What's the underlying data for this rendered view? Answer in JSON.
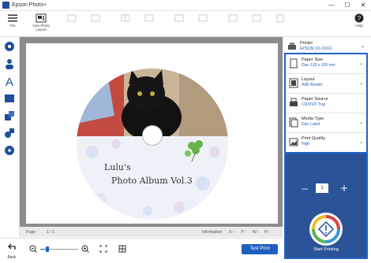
{
  "window": {
    "title": "Epson Photo+",
    "minimize": "—",
    "maximize": "☐",
    "close": "✕"
  },
  "toolbar": {
    "file_label": "File",
    "auto_photo_label": "Auto Photo\nLayout",
    "help_label": "Help"
  },
  "canvas": {
    "album_line1": "Lulu's",
    "album_line2": "Photo Album Vol.3"
  },
  "status": {
    "page_label": "Page:",
    "page_value": "1 / 1",
    "info_label": "Information:",
    "info_x": "X:-",
    "info_y": "Y:-",
    "info_w": "W:-",
    "info_h": "H:-"
  },
  "bottom": {
    "back_label": "Back",
    "test_print": "Test Print"
  },
  "printer": {
    "label": "Printer",
    "value": "EPSON XX-XXXX"
  },
  "settings": [
    {
      "label": "Paper Size",
      "value": "Disc 120 x 120 mm",
      "icon": "paper-size-icon"
    },
    {
      "label": "Layout",
      "value": "With Border",
      "icon": "layout-icon"
    },
    {
      "label": "Paper Source",
      "value": "CD/DVD Tray",
      "icon": "paper-source-icon"
    },
    {
      "label": "Media Type",
      "value": "Disc Label",
      "icon": "media-type-icon"
    },
    {
      "label": "Print Quality",
      "value": "High",
      "icon": "print-quality-icon"
    }
  ],
  "print_panel": {
    "copies": "1",
    "minus": "−",
    "plus": "+",
    "start_label": "Start Printing"
  },
  "colors": {
    "accent": "#1e64c8",
    "panel_blue": "#2b5398",
    "canvas_gray": "#8c8c8c"
  }
}
